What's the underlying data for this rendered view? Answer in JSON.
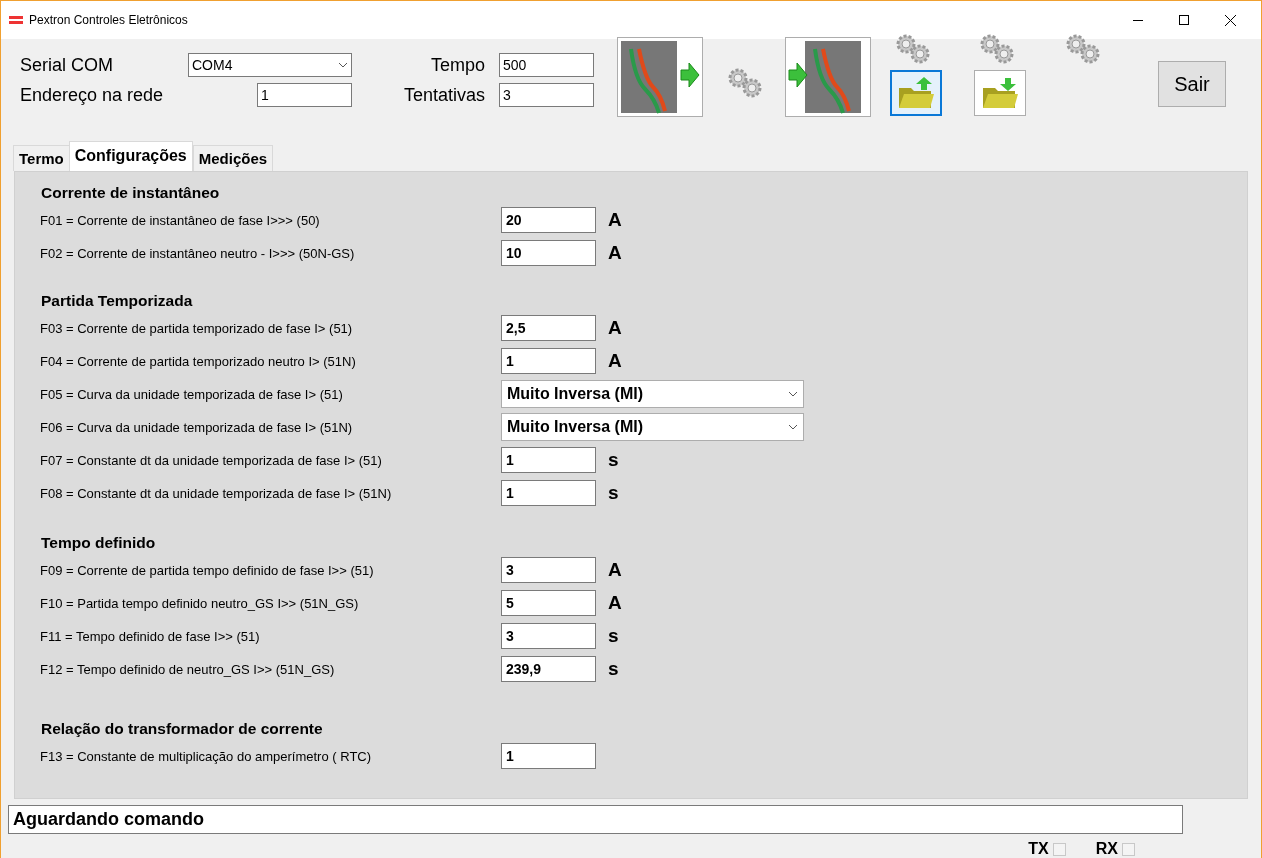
{
  "window": {
    "title": "Pextron Controles Eletrônicos"
  },
  "connection": {
    "serial_label": "Serial COM",
    "serial_value": "COM4",
    "address_label": "Endereço na rede",
    "address_value": "1",
    "time_label": "Tempo",
    "time_value": "500",
    "tries_label": "Tentativas",
    "tries_value": "3"
  },
  "toolbar": [
    {
      "kind": "read",
      "selected": false
    },
    {
      "kind": "write",
      "selected": false
    },
    {
      "kind": "open",
      "selected": true
    },
    {
      "kind": "save",
      "selected": false
    }
  ],
  "exit_button": "Sair",
  "tabs": [
    {
      "label": "Termo",
      "selected": false
    },
    {
      "label": "Configurações",
      "selected": true
    },
    {
      "label": "Medições",
      "selected": false
    }
  ],
  "sections": [
    {
      "title": "Corrente de instantâneo",
      "rows": [
        {
          "label": "F01 = Corrente de instantâneo de fase I>>> (50)",
          "kind": "input",
          "value": "20",
          "unit": "A"
        },
        {
          "label": "F02 = Corrente de instantâneo neutro - I>>> (50N-GS)",
          "kind": "input",
          "value": "10",
          "unit": "A"
        }
      ]
    },
    {
      "title": "Partida Temporizada",
      "rows": [
        {
          "label": "F03 = Corrente de partida temporizado de fase I> (51)",
          "kind": "input",
          "value": "2,5",
          "unit": "A"
        },
        {
          "label": "F04 = Corrente de partida temporizado neutro I> (51N)",
          "kind": "input",
          "value": "1",
          "unit": "A"
        },
        {
          "label": "F05 = Curva da unidade temporizada de fase I> (51)",
          "kind": "select",
          "value": "Muito Inversa (MI)"
        },
        {
          "label": "F06 = Curva da unidade temporizada de fase I> (51N)",
          "kind": "select",
          "value": "Muito Inversa (MI)"
        },
        {
          "label": "F07 = Constante dt da unidade temporizada de fase I> (51)",
          "kind": "input",
          "value": "1",
          "unit": "s"
        },
        {
          "label": "F08 =  Constante dt da unidade temporizada de fase I> (51N)",
          "kind": "input",
          "value": "1",
          "unit": "s"
        }
      ]
    },
    {
      "title": "Tempo definido",
      "rows": [
        {
          "label": "F09 = Corrente de partida tempo definido de fase I>> (51)",
          "kind": "input",
          "value": "3",
          "unit": "A"
        },
        {
          "label": "F10 = Partida tempo definido neutro_GS I>> (51N_GS)",
          "kind": "input",
          "value": "5",
          "unit": "A"
        },
        {
          "label": "F11 = Tempo definido de fase I>> (51)",
          "kind": "input",
          "value": "3",
          "unit": "s"
        },
        {
          "label": "F12 = Tempo definido de neutro_GS I>> (51N_GS)",
          "kind": "input",
          "value": "239,9",
          "unit": "s"
        }
      ]
    },
    {
      "title": "Relação do transformador de corrente",
      "rows": [
        {
          "label": "F13 = Constante de multiplicação do amperímetro ( RTC)",
          "kind": "input",
          "value": "1"
        }
      ]
    }
  ],
  "status": "Aguardando comando",
  "indicators": [
    {
      "label": "TX",
      "checked": false
    },
    {
      "label": "RX",
      "checked": false
    }
  ]
}
